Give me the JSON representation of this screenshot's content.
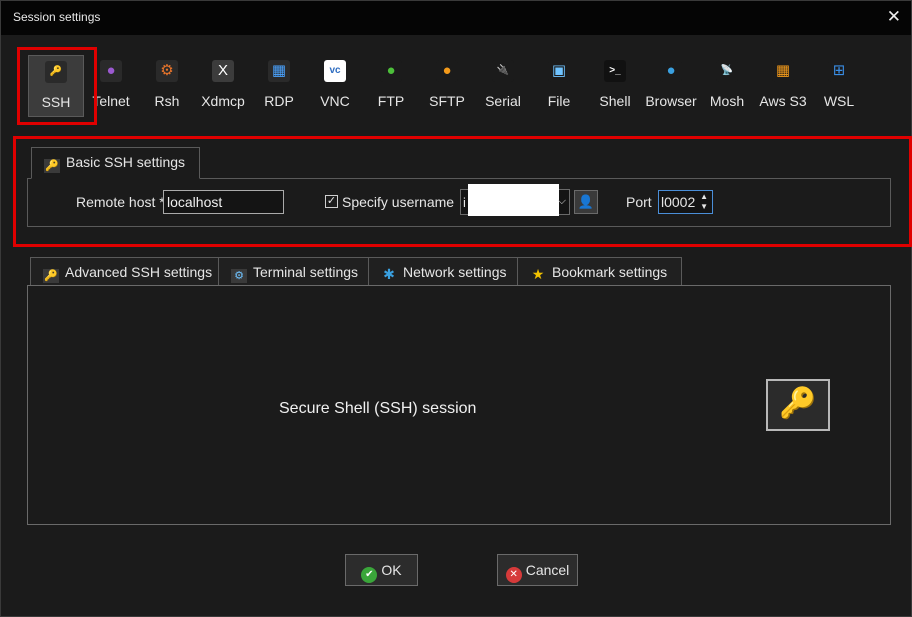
{
  "window": {
    "title": "Session settings",
    "close_glyph": "✕"
  },
  "protocols": [
    {
      "label": "SSH",
      "icon": "key-icon",
      "glyph": "🔑",
      "color": "#f2b800",
      "bg": "#2a2a2a",
      "active": true
    },
    {
      "label": "Telnet",
      "icon": "telnet-icon",
      "glyph": "●",
      "color": "#9b59d0",
      "bg": "#2a2a2a"
    },
    {
      "label": "Rsh",
      "icon": "rsh-icon",
      "glyph": "⚙",
      "color": "#e8742a",
      "bg": "#2a2a2a"
    },
    {
      "label": "Xdmcp",
      "icon": "xdmcp-icon",
      "glyph": "X",
      "color": "#ffffff",
      "bg": "#3c3c3c"
    },
    {
      "label": "RDP",
      "icon": "rdp-icon",
      "glyph": "▦",
      "color": "#4aa3ff",
      "bg": "#2a2a2a"
    },
    {
      "label": "VNC",
      "icon": "vnc-icon",
      "glyph": "vc",
      "color": "#2d6cc0",
      "bg": "#ffffff"
    },
    {
      "label": "FTP",
      "icon": "ftp-icon",
      "glyph": "●",
      "color": "#4cbf3a",
      "bg": "#1b1b1b"
    },
    {
      "label": "SFTP",
      "icon": "sftp-icon",
      "glyph": "●",
      "color": "#f39a1a",
      "bg": "#1b1b1b"
    },
    {
      "label": "Serial",
      "icon": "serial-icon",
      "glyph": "🔌",
      "color": "#cfcfcf",
      "bg": "#1b1b1b"
    },
    {
      "label": "File",
      "icon": "file-icon",
      "glyph": "▣",
      "color": "#6fc3ff",
      "bg": "#1b1b1b"
    },
    {
      "label": "Shell",
      "icon": "shell-icon",
      "glyph": ">_",
      "color": "#ffffff",
      "bg": "#111111"
    },
    {
      "label": "Browser",
      "icon": "browser-icon",
      "glyph": "●",
      "color": "#3aa0e0",
      "bg": "#1b1b1b"
    },
    {
      "label": "Mosh",
      "icon": "mosh-icon",
      "glyph": "📡",
      "color": "#3aa0e0",
      "bg": "#1b1b1b"
    },
    {
      "label": "Aws S3",
      "icon": "aws-s3-icon",
      "glyph": "▦",
      "color": "#f39a1a",
      "bg": "#1b1b1b"
    },
    {
      "label": "WSL",
      "icon": "wsl-icon",
      "glyph": "⊞",
      "color": "#3a8ee6",
      "bg": "#1b1b1b"
    }
  ],
  "basic": {
    "tab_label": "Basic SSH settings",
    "remote_host_label": "Remote host *",
    "remote_host_value": "localhost",
    "specify_username_label": "Specify username",
    "specify_username_checked": true,
    "check_glyph": "✓",
    "username_value": "i",
    "port_label": "Port",
    "port_value": "l0002"
  },
  "tabs": [
    {
      "label": "Advanced SSH settings",
      "icon": "key-icon"
    },
    {
      "label": "Terminal settings",
      "icon": "terminal-icon"
    },
    {
      "label": "Network settings",
      "icon": "network-icon"
    },
    {
      "label": "Bookmark settings",
      "icon": "star-icon"
    }
  ],
  "panel": {
    "description": "Secure Shell (SSH) session"
  },
  "buttons": {
    "ok": "OK",
    "cancel": "Cancel"
  },
  "colors": {
    "highlight": "#e00000",
    "ok_green": "#3aa63a",
    "cancel_red": "#d63a3a"
  }
}
